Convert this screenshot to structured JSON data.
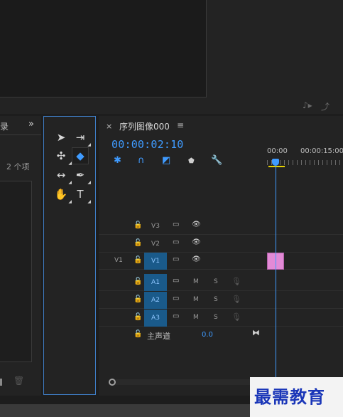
{
  "monitor": {
    "icons": [
      "audio-output-icon",
      "export-frame-icon"
    ]
  },
  "project": {
    "tab_label": "录",
    "more": "»",
    "item_count": "2 个项",
    "trash_icon": "trash-icon"
  },
  "tools": [
    {
      "name": "selection-tool",
      "glyph": "▶",
      "active": false
    },
    {
      "name": "track-select-tool",
      "glyph": "⇢",
      "active": false
    },
    {
      "name": "ripple-edit-tool",
      "glyph": "✣",
      "active": false
    },
    {
      "name": "razor-tool",
      "glyph": "◆",
      "active": true
    },
    {
      "name": "slip-tool",
      "glyph": "↔",
      "active": false
    },
    {
      "name": "pen-tool",
      "glyph": "✒",
      "active": false
    },
    {
      "name": "hand-tool",
      "glyph": "✋",
      "active": false
    },
    {
      "name": "type-tool",
      "glyph": "T",
      "active": false
    }
  ],
  "timeline": {
    "close": "×",
    "title": "序列图像000",
    "menu": "≡",
    "timecode": "00:00:02:10",
    "ruler": [
      "00:00",
      "00:00:15:00"
    ],
    "video_tracks": [
      {
        "label": "V3",
        "source": "",
        "target_on": false
      },
      {
        "label": "V2",
        "source": "",
        "target_on": false
      },
      {
        "label": "V1",
        "source": "V1",
        "target_on": true
      }
    ],
    "audio_tracks": [
      {
        "label": "A1",
        "mute": "M",
        "solo": "S"
      },
      {
        "label": "A2",
        "mute": "M",
        "solo": "S"
      },
      {
        "label": "A3",
        "mute": "M",
        "solo": "S"
      }
    ],
    "master": {
      "name": "主声道",
      "value": "0.0"
    },
    "clip_color": "#e38ad6",
    "accent": "#3f9bff"
  },
  "watermark": "最需教育"
}
